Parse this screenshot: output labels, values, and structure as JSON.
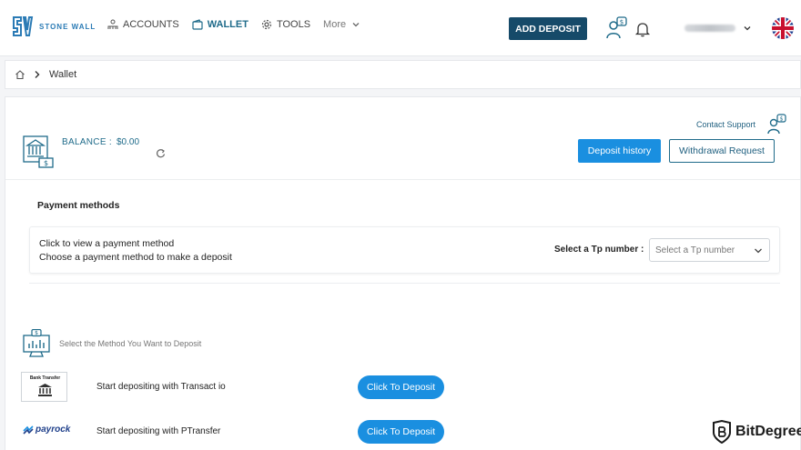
{
  "header": {
    "brand": "STONE WALL",
    "nav": [
      {
        "label": "ACCOUNTS",
        "icon": "accounts-icon"
      },
      {
        "label": "WALLET",
        "icon": "wallet-icon",
        "active": true
      },
      {
        "label": "TOOLS",
        "icon": "tools-gear-icon"
      },
      {
        "label": "More",
        "icon": "chevron-down-icon"
      }
    ],
    "add_deposit": "ADD DEPOSIT"
  },
  "breadcrumb": {
    "current": "Wallet"
  },
  "wallet": {
    "balance_label": "BALANCE :",
    "balance_value": "$0.00",
    "contact_support": "Contact Support",
    "deposit_history": "Deposit history",
    "withdrawal_request": "Withdrawal Request"
  },
  "payment_methods": {
    "title": "Payment methods",
    "line1": "Click to view a payment method",
    "line2": "Choose a payment method to make a deposit",
    "tp_label": "Select a Tp number :",
    "tp_placeholder": "Select a Tp number"
  },
  "deposit_methods": {
    "heading": "Select the Method You Want to Deposit",
    "rows": [
      {
        "logo_text": "Bank Transfer",
        "text": "Start depositing with Transact io",
        "button": "Click To Deposit"
      },
      {
        "logo_text": "payrock",
        "text": "Start depositing with PTransfer",
        "button": "Click To Deposit"
      }
    ]
  },
  "watermark": "BitDegree",
  "colors": {
    "primary_dark": "#164a69",
    "primary_blue": "#1a8fe0",
    "accent_teal": "#1f6b8a"
  }
}
